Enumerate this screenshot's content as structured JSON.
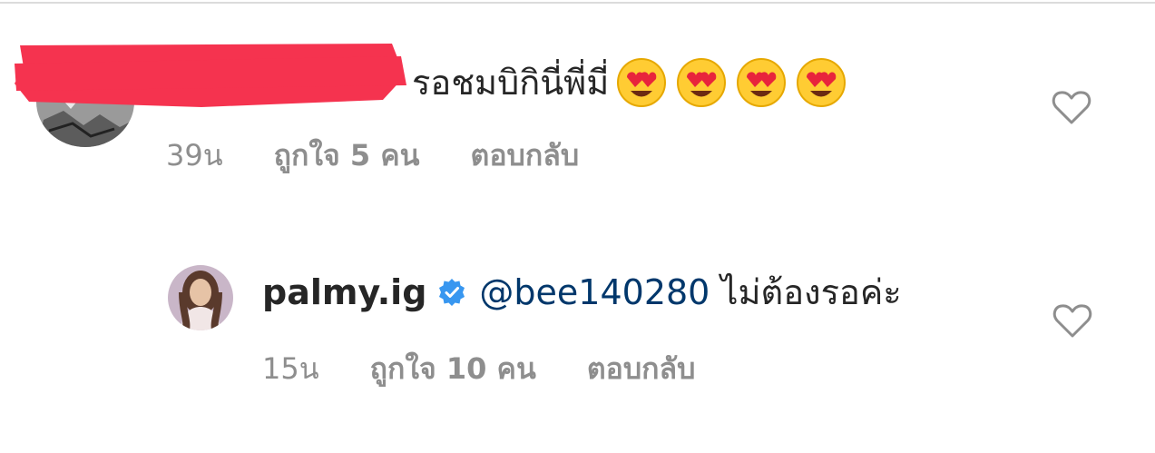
{
  "comments": [
    {
      "username": "",
      "text": "รอชมบิกินี่พี่มี่",
      "emojis": [
        "smiling-face-with-heart-eyes",
        "smiling-face-with-heart-eyes",
        "smiling-face-with-heart-eyes",
        "smiling-face-with-heart-eyes"
      ],
      "time": "39น",
      "likes": "ถูกใจ 5 คน",
      "reply_label": "ตอบกลับ",
      "redacted": true
    },
    {
      "username": "palmy.ig",
      "verified": true,
      "mention": "@bee140280",
      "text": "ไม่ต้องรอค่ะ",
      "time": "15น",
      "likes": "ถูกใจ 10 คน",
      "reply_label": "ตอบกลับ"
    }
  ],
  "colors": {
    "text": "#262626",
    "muted": "#8e8e8e",
    "mention": "#00376b",
    "verified": "#3897f0",
    "redaction": "#f5334f"
  }
}
